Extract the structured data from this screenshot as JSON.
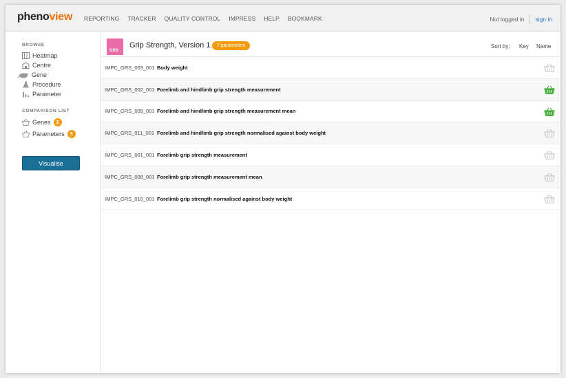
{
  "app": {
    "logo_part1": "pheno",
    "logo_part2": "view"
  },
  "nav": [
    "REPORTING",
    "TRACKER",
    "QUALITY CONTROL",
    "IMPRESS",
    "HELP",
    "BOOKMARK"
  ],
  "auth": {
    "status": "Not logged in",
    "sign_in": "sign in"
  },
  "sidebar": {
    "browse_title": "BROWSE",
    "browse_items": [
      "Heatmap",
      "Centre",
      "Gene",
      "Procedure",
      "Parameter"
    ],
    "comparison_title": "COMPARISON LIST",
    "comparison_items": [
      {
        "label": "Genes",
        "count": "2"
      },
      {
        "label": "Parameters",
        "count": "3"
      }
    ],
    "visualise_label": "Visualise"
  },
  "procedure": {
    "code_badge": "GRS",
    "badge_color": "#e96ca7",
    "title": "Grip Strength, Version 1.2",
    "params_badge": "7 parameters",
    "sort_label": "Sort by:",
    "sort_key": "Key",
    "sort_name": "Name"
  },
  "parameters": [
    {
      "code": "IMPC_GRS_003_001",
      "name": "Body weight",
      "selected": false
    },
    {
      "code": "IMPC_GRS_002_001",
      "name": "Forelimb and hindlimb grip strength measurement",
      "selected": true
    },
    {
      "code": "IMPC_GRS_009_001",
      "name": "Forelimb and hindlimb grip strength measurement mean",
      "selected": true
    },
    {
      "code": "IMPC_GRS_011_001",
      "name": "Forelimb and hindlimb grip strength normalised against body weight",
      "selected": false
    },
    {
      "code": "IMPC_GRS_001_001",
      "name": "Forelimb grip strength measurement",
      "selected": false
    },
    {
      "code": "IMPC_GRS_008_001",
      "name": "Forelimb grip strength measurement mean",
      "selected": false
    },
    {
      "code": "IMPC_GRS_010_001",
      "name": "Forelimb grip strength normalised against body weight",
      "selected": false
    }
  ],
  "colors": {
    "accent": "#e8720c",
    "badge": "#f39c12",
    "selected_basket": "#4caf3f",
    "unselected_basket": "#c8c8c8",
    "button": "#1a6f96"
  }
}
